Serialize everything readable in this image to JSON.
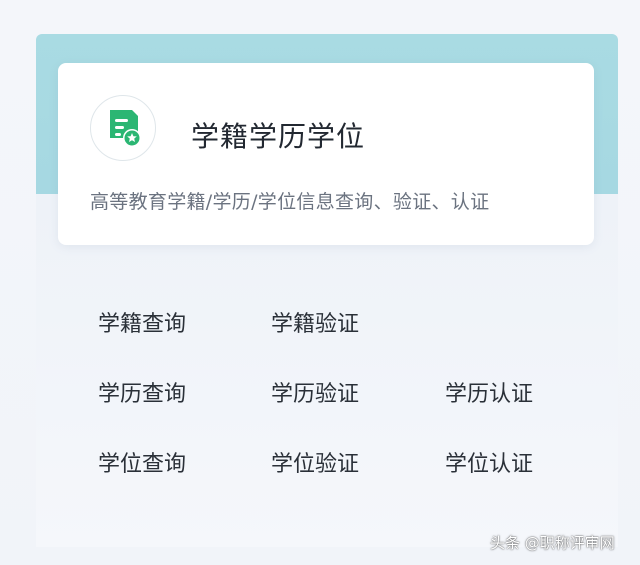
{
  "card": {
    "title": "学籍学历学位",
    "subtitle": "高等教育学籍/学历/学位信息查询、验证、认证"
  },
  "links": {
    "row1": [
      "学籍查询",
      "学籍验证"
    ],
    "row2": [
      "学历查询",
      "学历验证",
      "学历认证"
    ],
    "row3": [
      "学位查询",
      "学位验证",
      "学位认证"
    ]
  },
  "watermark": "头条 @职称评审网",
  "icons": {
    "card_icon": "document-star-icon"
  },
  "colors": {
    "banner": "#a9dbe3",
    "icon_green": "#2bb673",
    "text": "#2a3038"
  }
}
